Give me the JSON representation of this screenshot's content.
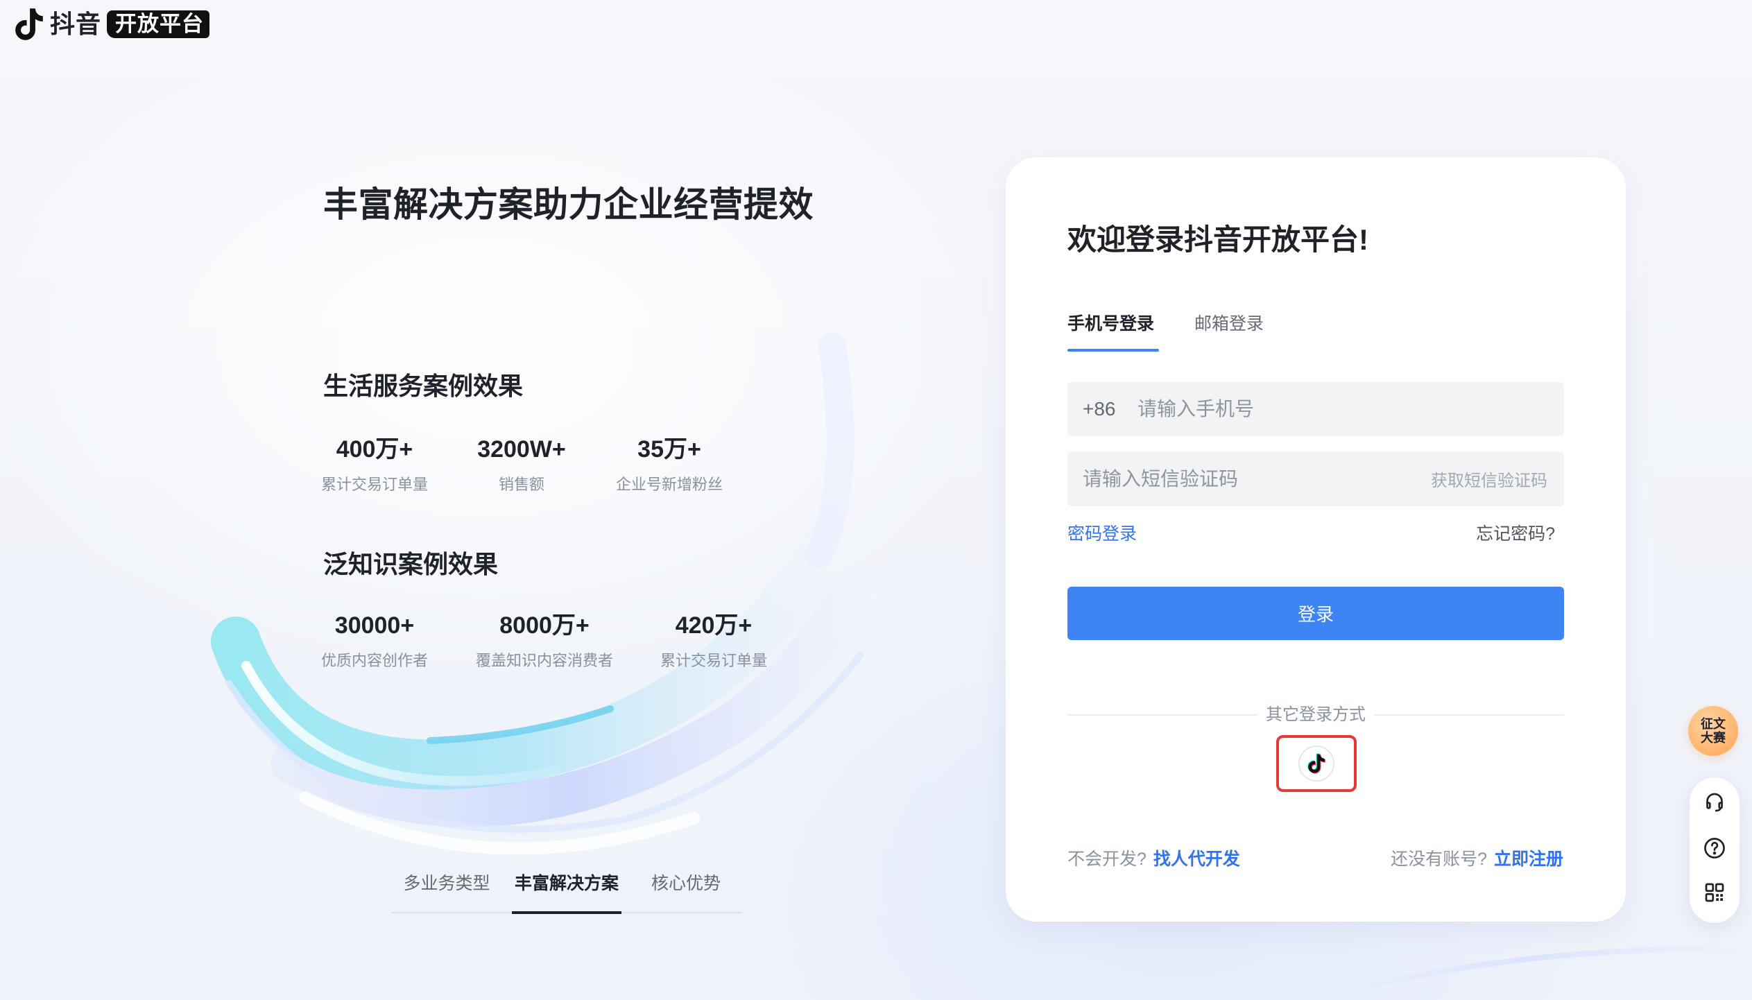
{
  "header": {
    "brand_name": "抖音",
    "brand_badge": "开放平台",
    "logo_icon": "douyin-logo-icon"
  },
  "hero": {
    "headline": "丰富解决方案助力企业经营提效",
    "sections": [
      {
        "title": "生活服务案例效果",
        "stats": [
          {
            "value": "400万+",
            "label": "累计交易订单量"
          },
          {
            "value": "3200W+",
            "label": "销售额"
          },
          {
            "value": "35万+",
            "label": "企业号新增粉丝"
          }
        ]
      },
      {
        "title": "泛知识案例效果",
        "stats": [
          {
            "value": "30000+",
            "label": "优质内容创作者"
          },
          {
            "value": "8000万+",
            "label": "覆盖知识内容消费者"
          },
          {
            "value": "420万+",
            "label": "累计交易订单量"
          }
        ]
      }
    ]
  },
  "carousel_tabs": [
    {
      "label": "多业务类型",
      "active": false
    },
    {
      "label": "丰富解决方案",
      "active": true
    },
    {
      "label": "核心优势",
      "active": false
    }
  ],
  "login": {
    "title": "欢迎登录抖音开放平台!",
    "tabs": [
      {
        "label": "手机号登录",
        "active": true
      },
      {
        "label": "邮箱登录",
        "active": false
      }
    ],
    "phone": {
      "country_code": "+86",
      "value": "",
      "placeholder": "请输入手机号"
    },
    "sms": {
      "value": "",
      "placeholder": "请输入短信验证码",
      "get_code_label": "获取短信验证码"
    },
    "password_login_link": "密码登录",
    "forgot_password_link": "忘记密码?",
    "submit_label": "登录",
    "other_methods_label": "其它登录方式",
    "other_methods": [
      {
        "icon": "douyin-icon"
      }
    ],
    "dev_prompt": "不会开发?",
    "dev_link": "找人代开发",
    "register_prompt": "还没有账号?",
    "register_link": "立即注册"
  },
  "side_widgets": {
    "contest_badge": {
      "line1": "征文",
      "line2": "大赛"
    },
    "buttons": [
      {
        "icon": "headset-icon"
      },
      {
        "icon": "question-icon"
      },
      {
        "icon": "qrcode-icon"
      }
    ]
  },
  "colors": {
    "primary": "#3d85f5",
    "link": "#2f73f0",
    "text": "#1f2329",
    "muted": "#8a919f",
    "highlight_border": "#e53935",
    "contest_badge": "#ffb36a"
  }
}
